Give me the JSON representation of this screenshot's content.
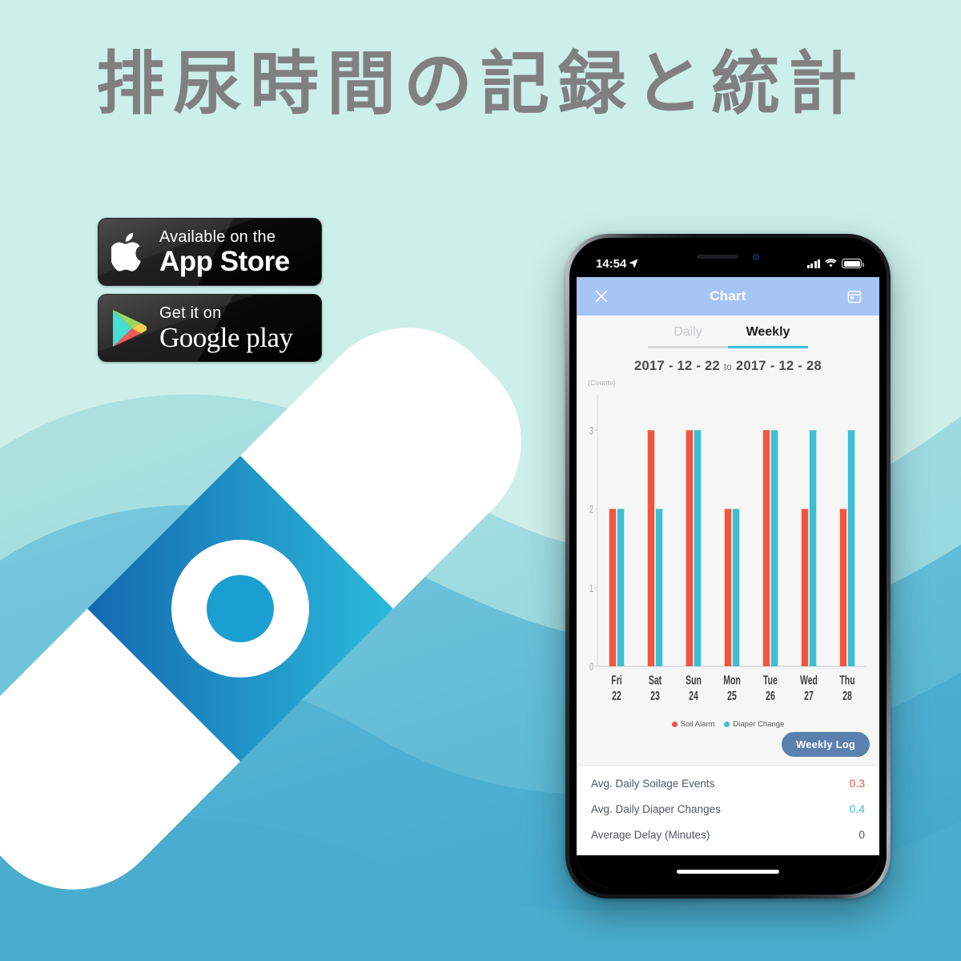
{
  "page": {
    "headline": "排尿時間の記録と統計",
    "headline_color": "#808080",
    "background_color": "#cdefe9"
  },
  "store_badges": [
    {
      "icon": "apple-icon",
      "small_label": "Available on the",
      "big_label": "App Store"
    },
    {
      "icon": "google-play-icon",
      "small_label": "Get it on",
      "big_label_1": "Google",
      "big_label_2": "play"
    }
  ],
  "phone": {
    "status_bar": {
      "time": "14:54",
      "location_icon": "location-arrow-icon",
      "signal_icon": "cellular-signal-icon",
      "wifi_icon": "wifi-icon",
      "battery_icon": "battery-full-icon"
    },
    "app_bar": {
      "close_icon": "close-icon",
      "title": "Chart",
      "calendar_icon": "calendar-icon",
      "background_color": "#a6c5f5"
    },
    "tabs": [
      {
        "label": "Daily",
        "active": false
      },
      {
        "label": "Weekly",
        "active": true
      }
    ],
    "date_range": {
      "start": "2017 - 12 - 22",
      "separator": "to",
      "end": "2017 - 12 - 28"
    },
    "legend": [
      {
        "label": "Soil Alarm",
        "color": "#f0553f"
      },
      {
        "label": "Diaper Change",
        "color": "#3cbfd3"
      }
    ],
    "weekly_log_button": "Weekly Log",
    "stats": [
      {
        "label": "Avg. Daily Soilage Events",
        "value": "0.3",
        "value_color": "#f0553f"
      },
      {
        "label": "Avg. Daily Diaper Changes",
        "value": "0.4",
        "value_color": "#3cbfd3"
      },
      {
        "label": "Average Delay (Minutes)",
        "value": "0",
        "value_color": "#4f5560"
      }
    ],
    "home_indicator": "home-indicator"
  },
  "chart_data": {
    "type": "bar",
    "title": "",
    "xlabel": "",
    "ylabel": "(Counts)",
    "ylim": [
      0,
      3.45
    ],
    "yticks": [
      0,
      1,
      2,
      3
    ],
    "ytick_labels": [
      "0",
      "1",
      "2",
      "3"
    ],
    "grid": false,
    "legend_position": "bottom",
    "categories": [
      "Fri\n22",
      "Sat\n23",
      "Sun\n24",
      "Mon\n25",
      "Tue\n26",
      "Wed\n27",
      "Thu\n28"
    ],
    "category_days": [
      "Fri",
      "Sat",
      "Sun",
      "Mon",
      "Tue",
      "Wed",
      "Thu"
    ],
    "category_dates": [
      "22",
      "23",
      "24",
      "25",
      "26",
      "27",
      "28"
    ],
    "series": [
      {
        "name": "Soil Alarm",
        "color": "#f0553f",
        "values": [
          2,
          3,
          3,
          2,
          3,
          2,
          2
        ]
      },
      {
        "name": "Diaper Change",
        "color": "#3cbfd3",
        "values": [
          2,
          2,
          3,
          2,
          3,
          3,
          3
        ]
      }
    ]
  }
}
